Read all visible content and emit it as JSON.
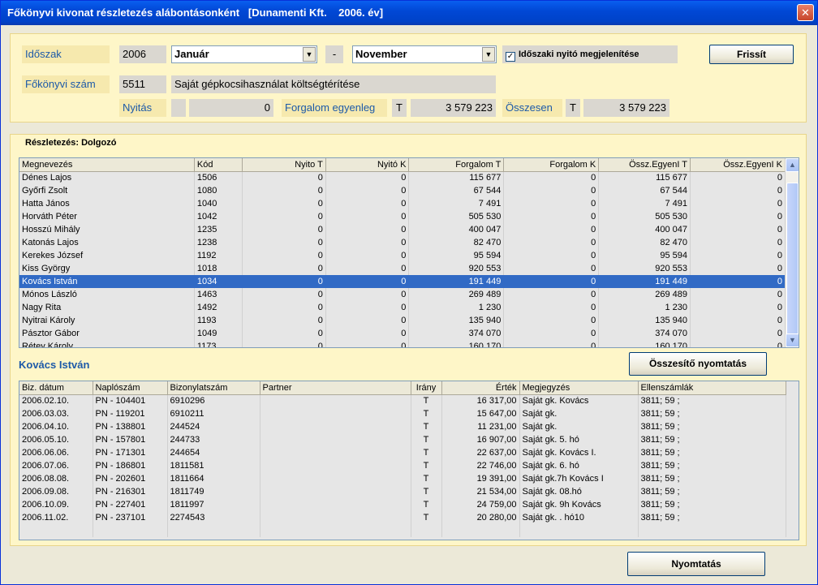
{
  "window": {
    "title": "Főkönyvi kivonat részletezés alábontásonként   [Dunamenti Kft.    2006. év]",
    "close_glyph": "✕"
  },
  "filters": {
    "period_label": "Időszak",
    "year": "2006",
    "from_month": "Január",
    "dash": "-",
    "to_month": "November",
    "show_opening_checked": true,
    "show_opening_label": "Időszaki nyitó megjelenítése",
    "refresh_button": "Frissít",
    "account_label": "Főkönyvi szám",
    "account_number": "5511",
    "account_name": "Saját gépkocsihasználat költségtérítése",
    "opening_label": "Nyitás",
    "opening_side": "",
    "opening_value": "0",
    "turnover_label": "Forgalom egyenleg",
    "turnover_side": "T",
    "turnover_value": "3 579 223",
    "total_label": "Összesen",
    "total_side": "T",
    "total_value": "3 579 223"
  },
  "detail": {
    "group_title": "Részletezés: Dolgozó",
    "columns": [
      "Megnevezés",
      "Kód",
      "Nyito T",
      "Nyitó K",
      "Forgalom T",
      "Forgalom K",
      "Össz.EgyenI T",
      "Össz.EgyenI K"
    ],
    "rows": [
      [
        "Dénes Lajos",
        "1506",
        "0",
        "0",
        "115 677",
        "0",
        "115 677",
        "0"
      ],
      [
        "Győrfi Zsolt",
        "1080",
        "0",
        "0",
        "67 544",
        "0",
        "67 544",
        "0"
      ],
      [
        "Hatta János",
        "1040",
        "0",
        "0",
        "7 491",
        "0",
        "7 491",
        "0"
      ],
      [
        "Horváth Péter",
        "1042",
        "0",
        "0",
        "505 530",
        "0",
        "505 530",
        "0"
      ],
      [
        "Hosszú Mihály",
        "1235",
        "0",
        "0",
        "400 047",
        "0",
        "400 047",
        "0"
      ],
      [
        "Katonás Lajos",
        "1238",
        "0",
        "0",
        "82 470",
        "0",
        "82 470",
        "0"
      ],
      [
        "Kerekes József",
        "1192",
        "0",
        "0",
        "95 594",
        "0",
        "95 594",
        "0"
      ],
      [
        "Kiss György",
        "1018",
        "0",
        "0",
        "920 553",
        "0",
        "920 553",
        "0"
      ],
      [
        "Kovács István",
        "1034",
        "0",
        "0",
        "191 449",
        "0",
        "191 449",
        "0"
      ],
      [
        "Mónos László",
        "1463",
        "0",
        "0",
        "269 489",
        "0",
        "269 489",
        "0"
      ],
      [
        "Nagy Rita",
        "1492",
        "0",
        "0",
        "1 230",
        "0",
        "1 230",
        "0"
      ],
      [
        "Nyitrai Károly",
        "1193",
        "0",
        "0",
        "135 940",
        "0",
        "135 940",
        "0"
      ],
      [
        "Pásztor Gábor",
        "1049",
        "0",
        "0",
        "374 070",
        "0",
        "374 070",
        "0"
      ],
      [
        "Rétey Károly",
        "1173",
        "0",
        "0",
        "160 170",
        "0",
        "160 170",
        "0"
      ]
    ],
    "selected_index": 8
  },
  "selected_person": "Kovács István",
  "summary_print_button": "Összesítő nyomtatás",
  "entries": {
    "columns": [
      "Biz. dátum",
      "Naplószám",
      "Bizonylatszám",
      "Partner",
      "Irány",
      "Érték",
      "Megjegyzés",
      "Ellenszámlák"
    ],
    "rows": [
      [
        "2006.02.10.",
        "PN - 104401",
        "6910296",
        "",
        "T",
        "16 317,00",
        "Saját gk. Kovács",
        "3811; 59 ;"
      ],
      [
        "2006.03.03.",
        "PN - 119201",
        "6910211",
        "",
        "T",
        "15 647,00",
        "Saját gk.",
        "3811; 59 ;"
      ],
      [
        "2006.04.10.",
        "PN - 138801",
        "244524",
        "",
        "T",
        "11 231,00",
        "Saját gk.",
        "3811; 59 ;"
      ],
      [
        "2006.05.10.",
        "PN - 157801",
        "244733",
        "",
        "T",
        "16 907,00",
        "Saját gk.   5. hó",
        "3811; 59 ;"
      ],
      [
        "2006.06.06.",
        "PN - 171301",
        "244654",
        "",
        "T",
        "22 637,00",
        "Saját gk. Kovács I.",
        "3811; 59 ;"
      ],
      [
        "2006.07.06.",
        "PN - 186801",
        "1811581",
        "",
        "T",
        "22 746,00",
        "Saját gk.  6. hó",
        "3811; 59 ;"
      ],
      [
        "2006.08.08.",
        "PN - 202601",
        "1811664",
        "",
        "T",
        "19 391,00",
        "Saját gk.7h Kovács I",
        "3811; 59 ;"
      ],
      [
        "2006.09.08.",
        "PN - 216301",
        "1811749",
        "",
        "T",
        "21 534,00",
        "Saját gk. 08.hó",
        "3811; 59 ;"
      ],
      [
        "2006.10.09.",
        "PN - 227401",
        "1811997",
        "",
        "T",
        "24 759,00",
        "Saját gk.  9h Kovács",
        "3811; 59 ;"
      ],
      [
        "2006.11.02.",
        "PN - 237101",
        "2274543",
        "",
        "T",
        "20 280,00",
        "Saját gk.   . hó10",
        "3811; 59 ;"
      ]
    ]
  },
  "print_button": "Nyomtatás"
}
